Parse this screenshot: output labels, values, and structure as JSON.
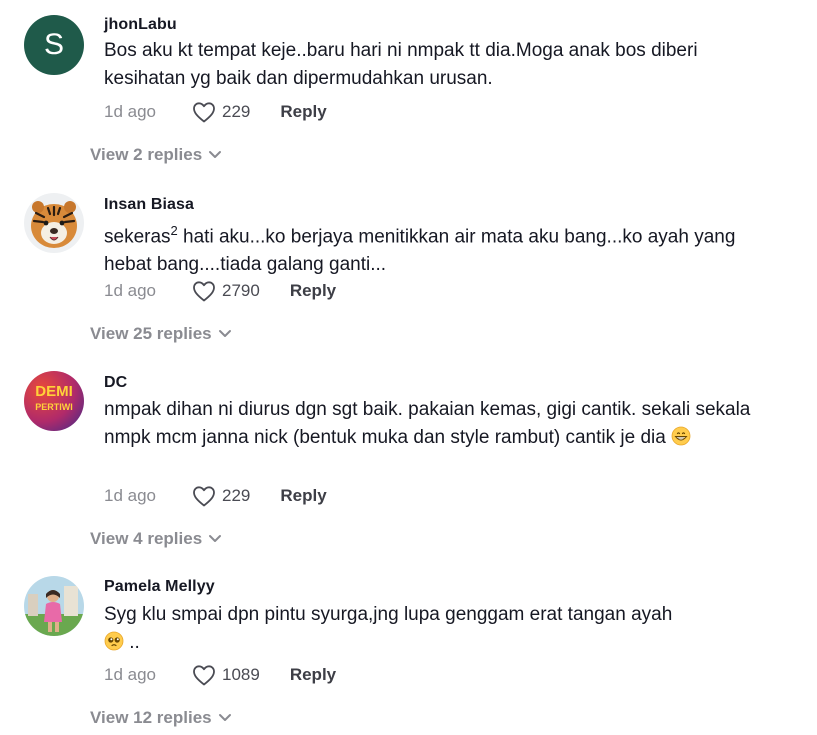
{
  "comments": [
    {
      "username": "jhonLabu",
      "avatar_letter": "S",
      "text": "Bos aku kt tempat keje..baru hari ni nmpak tt dia.Moga anak bos diberi kesihatan yg baik dan dipermudahkan urusan.",
      "time": "1d ago",
      "likes": "229",
      "reply_label": "Reply",
      "view_replies": "View 2 replies"
    },
    {
      "username": "Insan Biasa",
      "avatar_icon": "tiger-avatar",
      "text_before_sup": "sekeras",
      "text_sup": "2",
      "text_after_sup": " hati aku...ko berjaya menitikkan air mata aku bang...ko ayah yang hebat bang....tiada galang ganti...",
      "time": "1d ago",
      "likes": "2790",
      "reply_label": "Reply",
      "view_replies": "View 25 replies"
    },
    {
      "username": "DC",
      "avatar_line1": "DEMI",
      "avatar_line2": "PERTIWI",
      "text": "nmpak dihan ni diurus dgn sgt baik. pakaian kemas, gigi cantik. sekali sekala nmpk mcm janna nick (bentuk muka dan style rambut) cantik je dia",
      "emoji": "grinning-face-emoji",
      "time": "1d ago",
      "likes": "229",
      "reply_label": "Reply",
      "view_replies": "View 4 replies"
    },
    {
      "username": "Pamela Mellyy",
      "avatar_icon": "person-photo-avatar",
      "text": "Syg klu smpai dpn pintu syurga,jng lupa genggam erat tangan ayah",
      "text_tail": " ..",
      "emoji": "pleading-face-emoji",
      "time": "1d ago",
      "likes": "1089",
      "reply_label": "Reply",
      "view_replies": "View 12 replies"
    }
  ],
  "colors": {
    "text": "#161823",
    "muted": "#8a8b91",
    "avatar_s_bg": "#1f5a4a"
  }
}
